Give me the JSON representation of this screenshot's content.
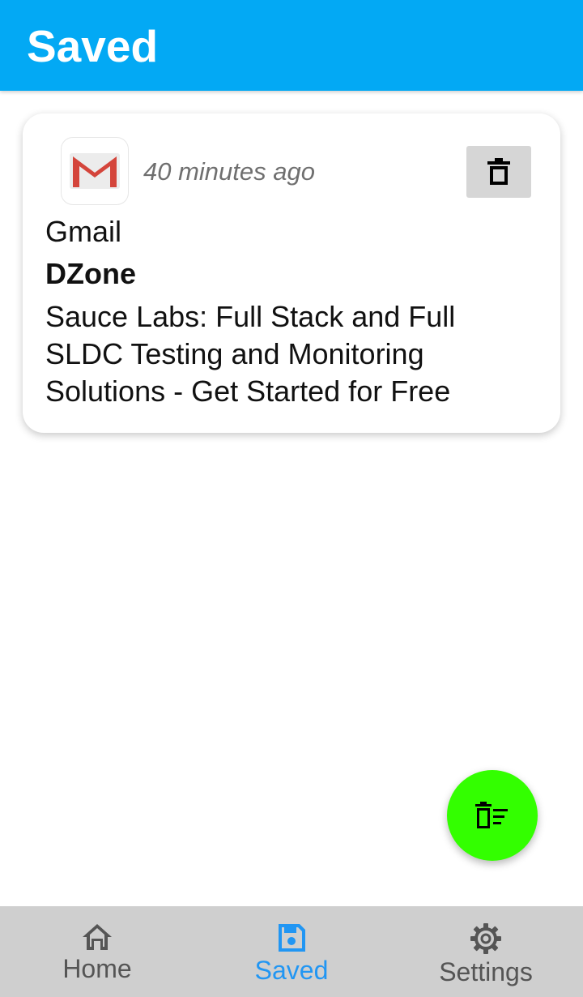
{
  "header": {
    "title": "Saved"
  },
  "colors": {
    "header_bg": "#03a9f4",
    "fab_bg": "#33ff00",
    "nav_bg": "#cfcfcf",
    "nav_active": "#2196f3",
    "nav_inactive": "#555555"
  },
  "saved": [
    {
      "app_icon": "gmail-icon",
      "app_name": "Gmail",
      "timestamp": "40 minutes ago",
      "sender": "DZone",
      "message": "Sauce Labs: Full Stack and Full SLDC Testing and Monitoring Solutions - Get Started for Free",
      "delete_icon": "trash-icon"
    }
  ],
  "fab": {
    "icon": "delete-sweep-icon"
  },
  "bottom_nav": {
    "items": [
      {
        "label": "Home",
        "icon": "home-icon",
        "active": false
      },
      {
        "label": "Saved",
        "icon": "save-icon",
        "active": true
      },
      {
        "label": "Settings",
        "icon": "gear-icon",
        "active": false
      }
    ]
  }
}
